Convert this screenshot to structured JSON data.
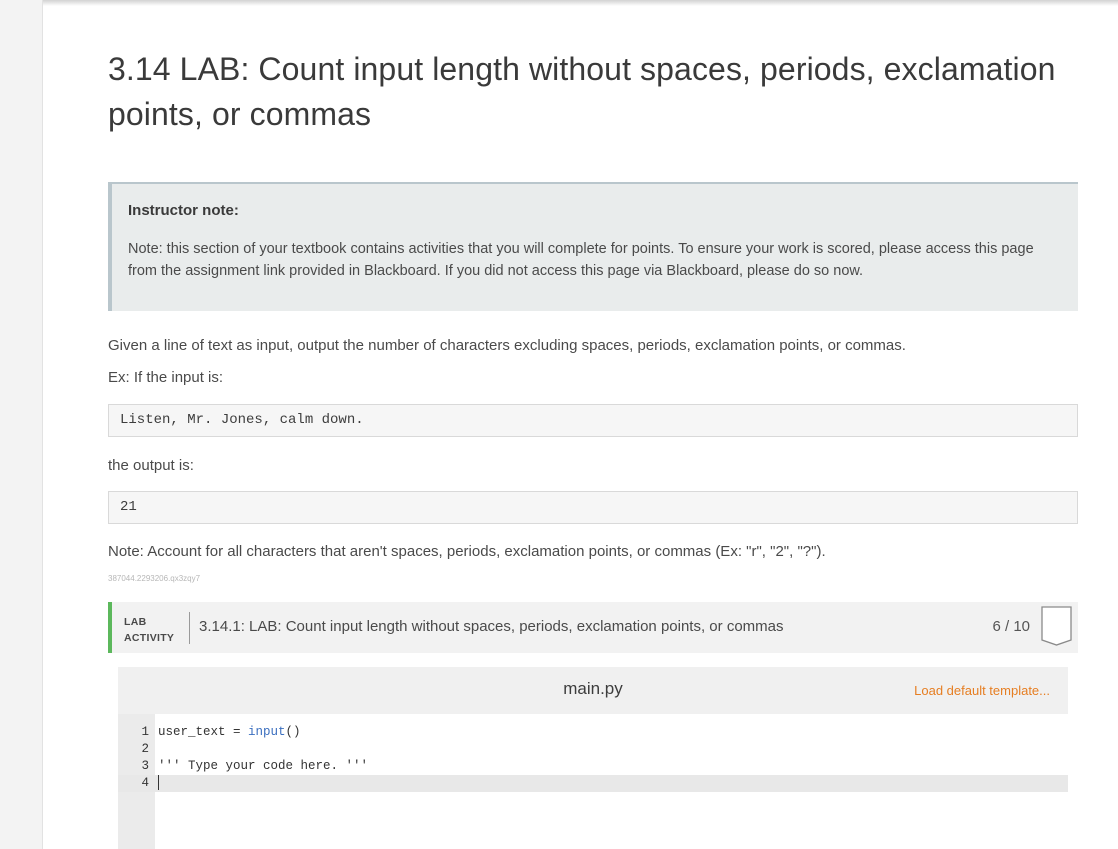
{
  "page": {
    "title": "3.14 LAB: Count input length without spaces, periods, exclamation points, or commas"
  },
  "instructor_note": {
    "heading": "Instructor note:",
    "body": "Note: this section of your textbook contains activities that you will complete for points. To ensure your work is scored, please access this page from the assignment link provided in Blackboard. If you did not access this page via Blackboard, please do so now."
  },
  "description": {
    "intro": "Given a line of text as input, output the number of characters excluding spaces, periods, exclamation points, or commas.",
    "example_label": "Ex: If the input is:",
    "example_input": "Listen, Mr. Jones, calm down.",
    "output_label": "the output is:",
    "example_output": "21",
    "note": "Note: Account for all characters that aren't spaces, periods, exclamation points, or commas (Ex: \"r\", \"2\", \"?\").",
    "reference_id": "387044.2293206.qx3zqy7"
  },
  "lab_activity": {
    "label": "LAB ACTIVITY",
    "title": "3.14.1: LAB: Count input length without spaces, periods, exclamation points, or commas",
    "score": "6 / 10",
    "accent_color": "#5cb85c"
  },
  "editor": {
    "filename": "main.py",
    "load_template_label": "Load default template...",
    "lines": [
      {
        "number": "1",
        "code": "user_text = input()"
      },
      {
        "number": "2",
        "code": ""
      },
      {
        "number": "3",
        "code": "''' Type your code here. '''"
      },
      {
        "number": "4",
        "code": ""
      }
    ]
  }
}
